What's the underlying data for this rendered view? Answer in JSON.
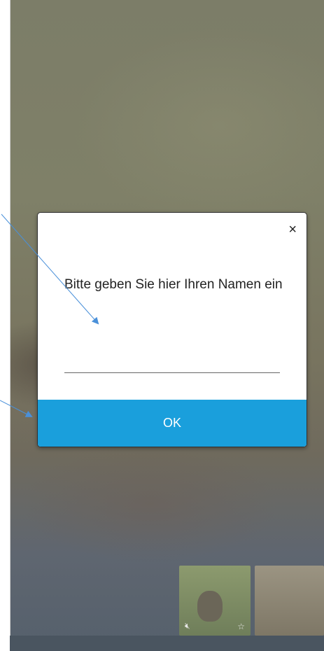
{
  "dialog": {
    "prompt": "Bitte geben Sie hier Ihren Namen ein",
    "name_value": "",
    "ok_label": "OK",
    "close_label": "×"
  },
  "thumbnails": [
    {
      "mic_icon": "mic-off-icon",
      "star_icon": "star-icon"
    },
    {}
  ],
  "colors": {
    "ok_button": "#1a9fdc",
    "annotation_arrow": "#4a90d9"
  }
}
